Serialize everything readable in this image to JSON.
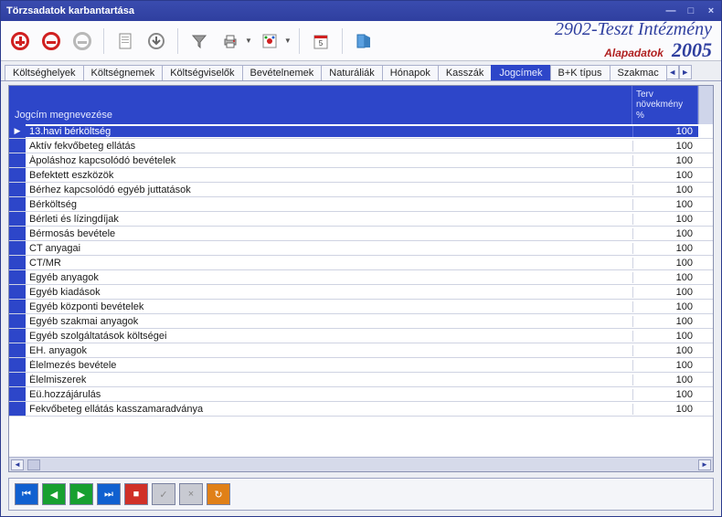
{
  "window": {
    "title": "Törzsadatok karbantartása"
  },
  "header": {
    "orgName": "2902-Teszt Intézmény",
    "subtitle": "Alapadatok",
    "year": "2005"
  },
  "tabs": {
    "items": [
      "Költséghelyek",
      "Költségnemek",
      "Költségviselők",
      "Bevételnemek",
      "Naturáliák",
      "Hónapok",
      "Kasszák",
      "Jogcímek",
      "B+K típus",
      "Szakmac"
    ],
    "activeIndex": 7
  },
  "grid": {
    "columns": {
      "name": "Jogcím megnevezése",
      "value": "Terv\nnövekmény\n%"
    },
    "rows": [
      {
        "name": "13.havi bérköltség",
        "value": "100",
        "selected": true
      },
      {
        "name": "Aktív fekvőbeteg ellátás",
        "value": "100"
      },
      {
        "name": "Ápoláshoz kapcsolódó bevételek",
        "value": "100"
      },
      {
        "name": "Befektett eszközök",
        "value": "100"
      },
      {
        "name": "Bérhez kapcsolódó egyéb juttatások",
        "value": "100"
      },
      {
        "name": "Bérköltség",
        "value": "100"
      },
      {
        "name": "Bérleti és lízingdíjak",
        "value": "100"
      },
      {
        "name": "Bérmosás bevétele",
        "value": "100"
      },
      {
        "name": "CT anyagai",
        "value": "100"
      },
      {
        "name": "CT/MR",
        "value": "100"
      },
      {
        "name": "Egyéb anyagok",
        "value": "100"
      },
      {
        "name": "Egyéb kiadások",
        "value": "100"
      },
      {
        "name": "Egyéb központi bevételek",
        "value": "100"
      },
      {
        "name": "Egyéb szakmai anyagok",
        "value": "100"
      },
      {
        "name": "Egyéb szolgáltatások költségei",
        "value": "100"
      },
      {
        "name": "EH. anyagok",
        "value": "100"
      },
      {
        "name": "Élelmezés bevétele",
        "value": "100"
      },
      {
        "name": "Élelmiszerek",
        "value": "100"
      },
      {
        "name": "Eü.hozzájárulás",
        "value": "100"
      },
      {
        "name": "Fekvőbeteg ellátás kasszamaradványa",
        "value": "100"
      }
    ]
  }
}
